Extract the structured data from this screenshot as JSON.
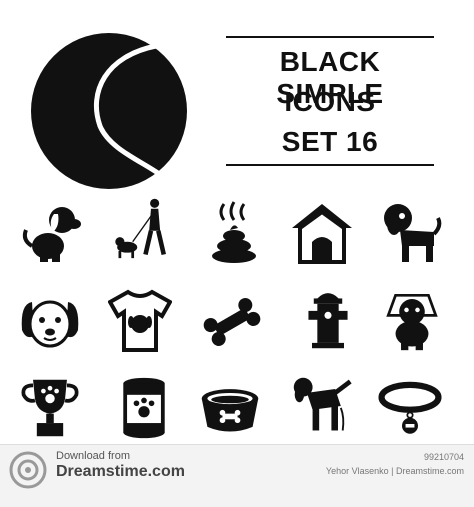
{
  "title": {
    "line1": "BLACK SIMPLE",
    "line2": "ICONS",
    "line3": "SET 16"
  },
  "colors": {
    "ink": "#111111",
    "background": "#ffffff",
    "footer": "#f3f3f3"
  },
  "icons": [
    "tennis-ball-icon",
    "sitting-puppy-icon",
    "dog-walker-icon",
    "dog-poop-icon",
    "dog-house-icon",
    "standing-dog-icon",
    "dog-face-icon",
    "dog-print-tshirt-icon",
    "dog-bone-icon",
    "fire-hydrant-icon",
    "dog-with-cone-icon",
    "paw-trophy-icon",
    "pet-food-can-icon",
    "dog-bowl-icon",
    "peeing-dog-icon",
    "dog-collar-icon"
  ],
  "watermark": {
    "download_from": "Download from",
    "site": "Dreamstime.com",
    "id": "99210704",
    "credit": "Yehor Vlasenko | Dreamstime.com"
  }
}
